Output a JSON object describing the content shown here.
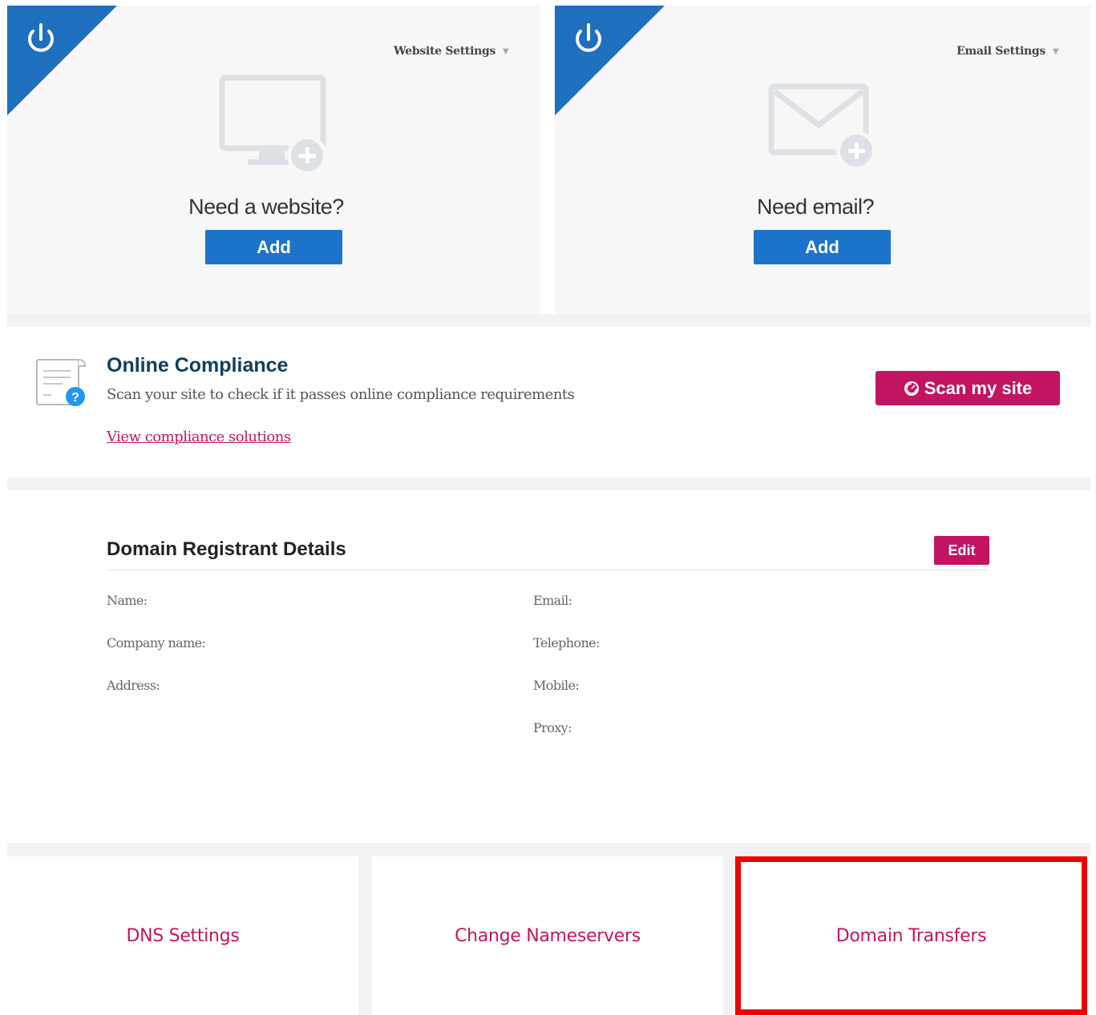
{
  "website_card": {
    "settings_label": "Website Settings",
    "prompt": "Need a website?",
    "add_label": "Add"
  },
  "email_card": {
    "settings_label": "Email Settings",
    "prompt": "Need email?",
    "add_label": "Add"
  },
  "compliance": {
    "title": "Online Compliance",
    "description": "Scan your site to check if it passes online compliance requirements",
    "link_label": "View compliance solutions",
    "scan_label": "Scan my site"
  },
  "registrant": {
    "title": "Domain Registrant Details",
    "edit_label": "Edit",
    "fields_left": [
      "Name:",
      "Company name:",
      "Address:"
    ],
    "fields_right": [
      "Email:",
      "Telephone:",
      "Mobile:",
      "Proxy:"
    ]
  },
  "tiles": [
    "DNS Settings",
    "Change Nameservers",
    "Domain Transfers"
  ],
  "colors": {
    "primary_blue": "#1b74c9",
    "accent_magenta": "#c21461",
    "highlight_red": "#ee0000"
  }
}
